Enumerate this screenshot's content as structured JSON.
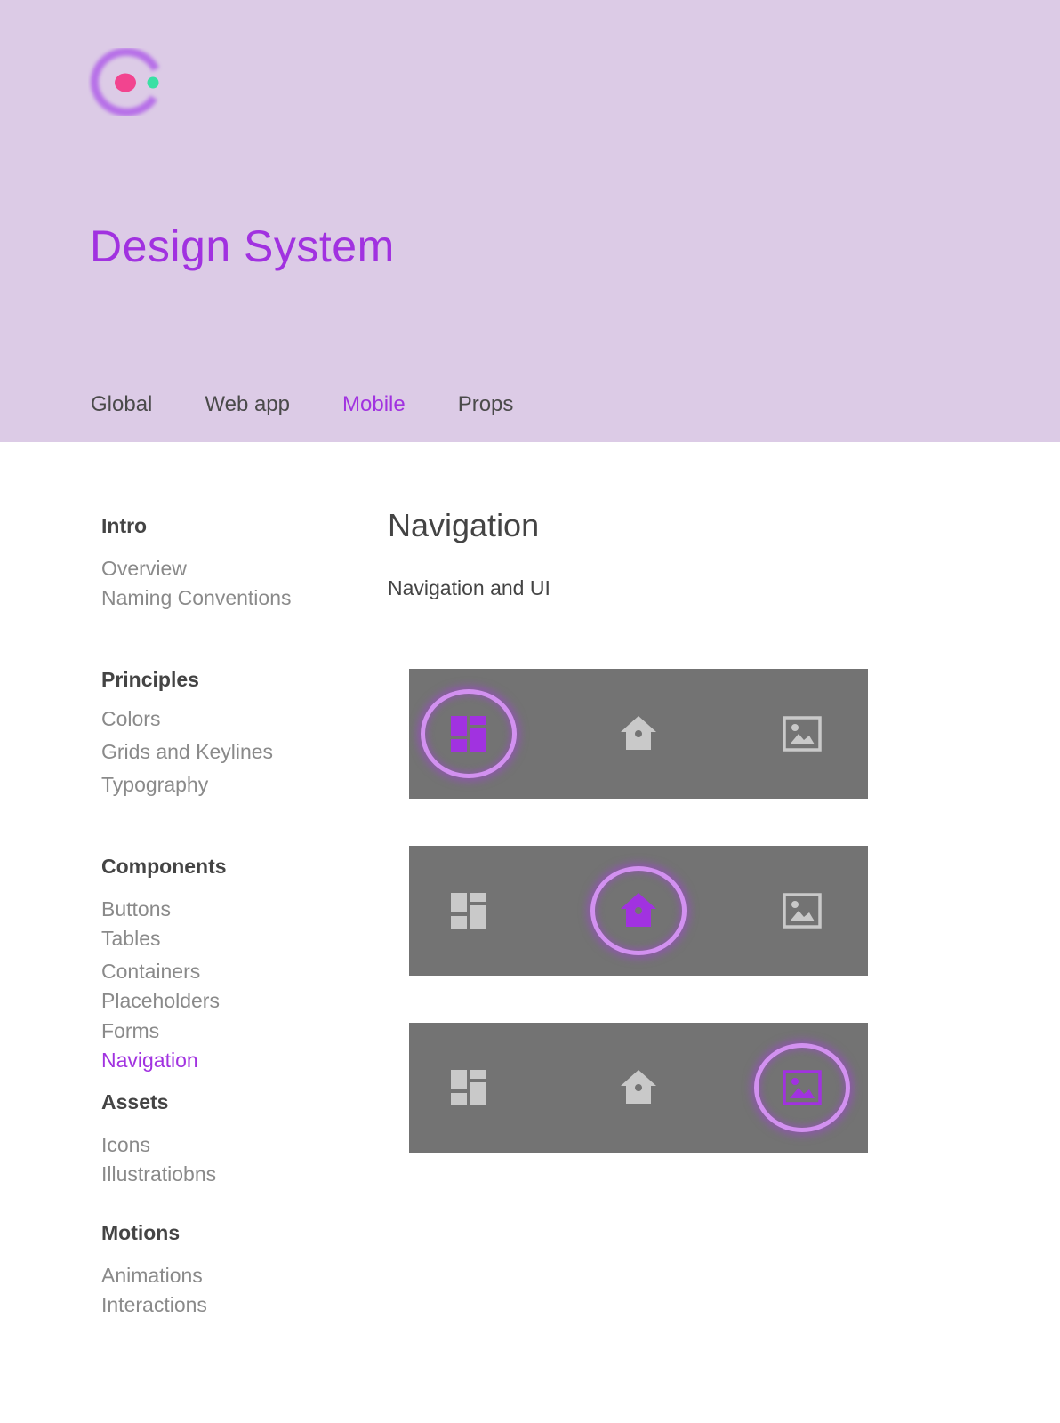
{
  "colors": {
    "header_bg": "#dccbe6",
    "accent": "#a132e0",
    "icon_inactive": "#c9c9c9",
    "navbar_bg": "#737373",
    "logo_dot_pink": "#f2448f",
    "logo_dot_green": "#39e0a4"
  },
  "header": {
    "title": "Design System",
    "tabs": [
      {
        "label": "Global",
        "active": false
      },
      {
        "label": "Web app",
        "active": false
      },
      {
        "label": "Mobile",
        "active": true
      },
      {
        "label": "Props",
        "active": false
      }
    ]
  },
  "sidebar": {
    "groups": [
      {
        "heading": "Intro",
        "items": [
          "Overview",
          "Naming Conventions"
        ]
      },
      {
        "heading": "Principles",
        "items": [
          "Colors",
          "Grids and Keylines",
          "Typography"
        ]
      },
      {
        "heading": "Components",
        "items": [
          "Buttons",
          "Tables",
          "Containers",
          "Placeholders",
          "Forms",
          "Navigation"
        ],
        "active_item": "Navigation"
      },
      {
        "heading": "Assets",
        "items": [
          "Icons",
          "Illustratiobns"
        ]
      },
      {
        "heading": "Motions",
        "items": [
          "Animations",
          "Interactions"
        ]
      }
    ]
  },
  "main": {
    "title": "Navigation",
    "subtitle": "Navigation and UI",
    "navbars": [
      {
        "active_icon": "dashboard-icon",
        "icons": [
          "dashboard-icon",
          "home-icon",
          "image-icon"
        ]
      },
      {
        "active_icon": "home-icon",
        "icons": [
          "dashboard-icon",
          "home-icon",
          "image-icon"
        ]
      },
      {
        "active_icon": "image-icon",
        "icons": [
          "dashboard-icon",
          "home-icon",
          "image-icon"
        ]
      }
    ]
  }
}
